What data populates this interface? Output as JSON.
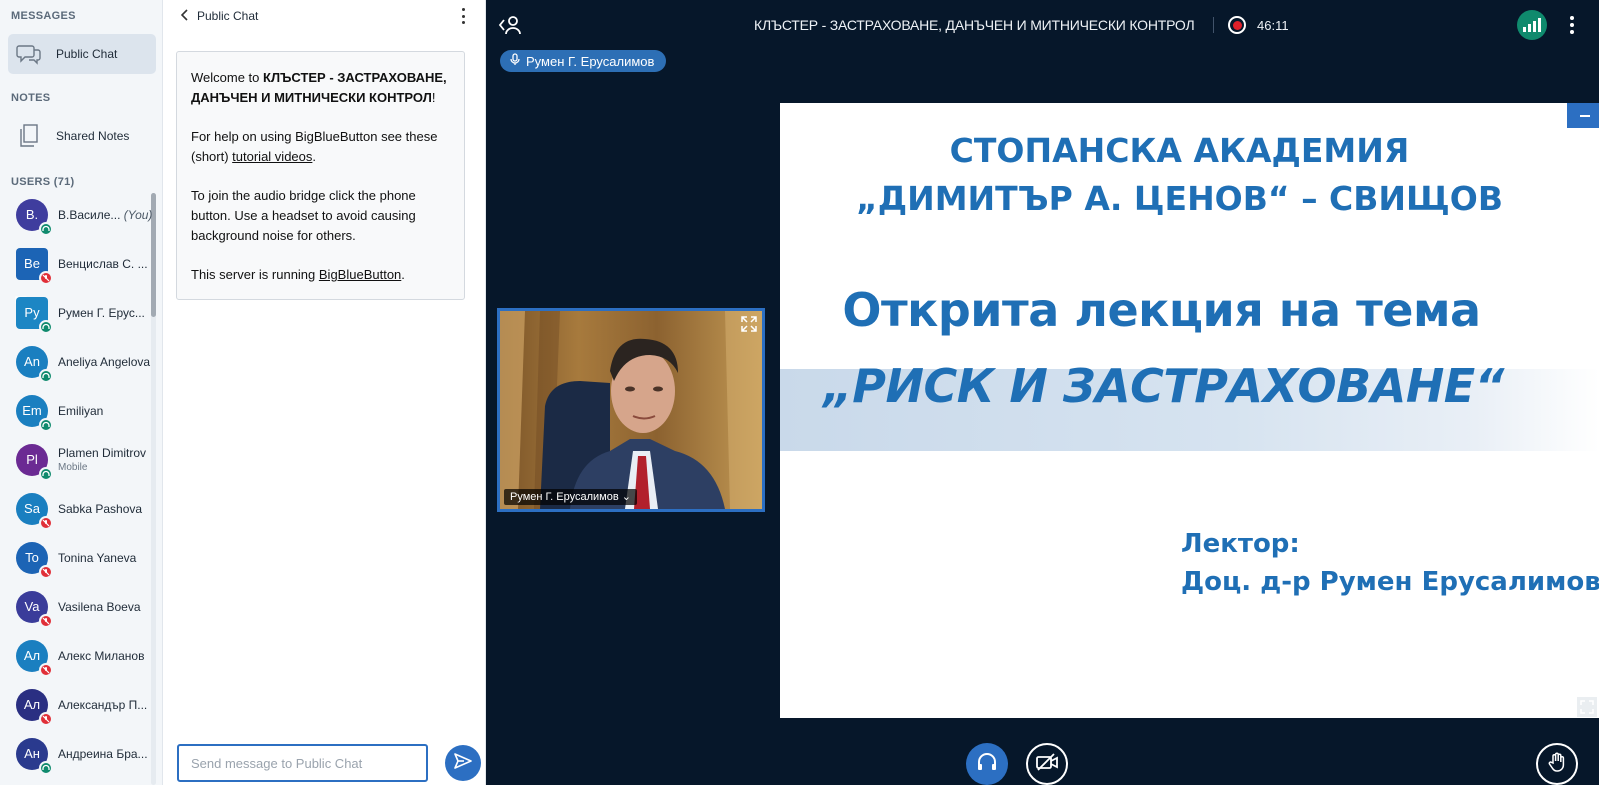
{
  "sidebar": {
    "messages_title": "MESSAGES",
    "public_chat_label": "Public Chat",
    "notes_title": "NOTES",
    "shared_notes_label": "Shared Notes",
    "users_title": "USERS (71)",
    "users": [
      {
        "initials": "B.",
        "name": "В.Василе...",
        "you": "(You)",
        "sub": "",
        "color": "#3f3d9e",
        "status": "listen"
      },
      {
        "initials": "Be",
        "name": "Венцислав С. ...",
        "sub": "",
        "color": "#1c64b5",
        "status": "muted"
      },
      {
        "initials": "Py",
        "name": "Румен Г. Ерус...",
        "sub": "",
        "color": "#1c86c4",
        "status": "listen"
      },
      {
        "initials": "An",
        "name": "Aneliya Angelova",
        "sub": "",
        "color": "#1a7fc0",
        "status": "listen"
      },
      {
        "initials": "Em",
        "name": "Emiliyan",
        "sub": "",
        "color": "#1a7fc0",
        "status": "listen"
      },
      {
        "initials": "Pl",
        "name": "Plamen Dimitrov",
        "sub": "Mobile",
        "color": "#6b2a93",
        "status": "listen"
      },
      {
        "initials": "Sa",
        "name": "Sabka Pashova",
        "sub": "",
        "color": "#1a7fc0",
        "status": "muted"
      },
      {
        "initials": "To",
        "name": "Tonina Yaneva",
        "sub": "",
        "color": "#1c64b5",
        "status": "muted"
      },
      {
        "initials": "Va",
        "name": "Vasilena Boeva",
        "sub": "",
        "color": "#3a3c9a",
        "status": "muted"
      },
      {
        "initials": "Ал",
        "name": "Алекс Миланов",
        "sub": "",
        "color": "#1a7fc0",
        "status": "muted"
      },
      {
        "initials": "Ал",
        "name": "Александър П...",
        "sub": "",
        "color": "#2a2f82",
        "status": "muted"
      },
      {
        "initials": "Ан",
        "name": "Андреина Бра...",
        "sub": "",
        "color": "#2a3a8e",
        "status": "listen"
      }
    ]
  },
  "chat": {
    "title": "Public Chat",
    "welcome_prefix": "Welcome to ",
    "welcome_meeting": "КЛЪСТЕР - ЗАСТРАХОВАНЕ, ДАНЪЧЕН И МИТНИЧЕСКИ КОНТРОЛ",
    "welcome_suffix": "!",
    "help_prefix": "For help on using BigBlueButton see these (short) ",
    "help_link": "tutorial videos",
    "help_suffix": ".",
    "audio_text": "To join the audio bridge click the phone button. Use a headset to avoid causing background noise for others.",
    "server_prefix": "This server is running ",
    "server_link": "BigBlueButton",
    "server_suffix": ".",
    "input_placeholder": "Send message to Public Chat"
  },
  "topbar": {
    "meeting_title": "КЛЪСТЕР - ЗАСТРАХОВАНЕ, ДАНЪЧЕН И МИТНИЧЕСКИ КОНТРОЛ",
    "recording_time": "46:11"
  },
  "talking_indicator": "Румен Г. Ерусалимов",
  "webcam": {
    "user_label": "Румен Г. Ерусалимов ⌄"
  },
  "slide": {
    "line1": "СТОПАНСКА АКАДЕМИЯ",
    "line2": "„ДИМИТЪР А. ЦЕНОВ“ – СВИЩОВ",
    "line3": "Открита лекция на тема",
    "line4": "„РИСК И ЗАСТРАХОВАНЕ“",
    "lecturer_label": "Лектор:",
    "lecturer_name": "Доц. д-р Румен Ерусалимов"
  },
  "colors": {
    "accent": "#2c6fc2",
    "background": "#06172a",
    "slide_text": "#1f6fb5",
    "listen_status": "#0f8a6d",
    "muted_status": "#e02f38"
  }
}
